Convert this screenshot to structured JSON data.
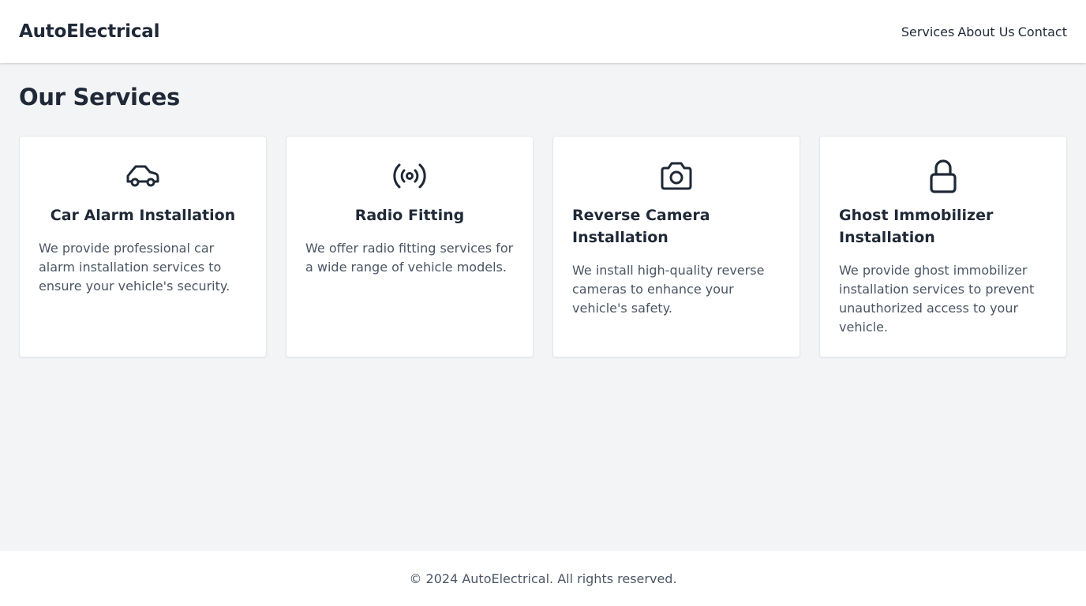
{
  "header": {
    "brand": "AutoElectrical",
    "nav": [
      {
        "label": "Services"
      },
      {
        "label": "About Us"
      },
      {
        "label": "Contact"
      }
    ]
  },
  "main": {
    "title": "Our Services",
    "cards": [
      {
        "icon": "car-icon",
        "title": "Car Alarm Installation",
        "description": "We provide professional car alarm installation services to ensure your vehicle's security."
      },
      {
        "icon": "radio-signal-icon",
        "title": "Radio Fitting",
        "description": "We offer radio fitting services for a wide range of vehicle models."
      },
      {
        "icon": "camera-icon",
        "title": "Reverse Camera Installation",
        "description": "We install high-quality reverse cameras to enhance your vehicle's safety."
      },
      {
        "icon": "lock-icon",
        "title": "Ghost Immobilizer Installation",
        "description": "We provide ghost immobilizer installation services to prevent unauthorized access to your vehicle."
      }
    ]
  },
  "footer": {
    "copyright": "© 2024 AutoElectrical. All rights reserved."
  },
  "colors": {
    "background": "#f3f4f6",
    "surface": "#ffffff",
    "text_primary": "#1f2937",
    "text_secondary": "#4b5563"
  }
}
